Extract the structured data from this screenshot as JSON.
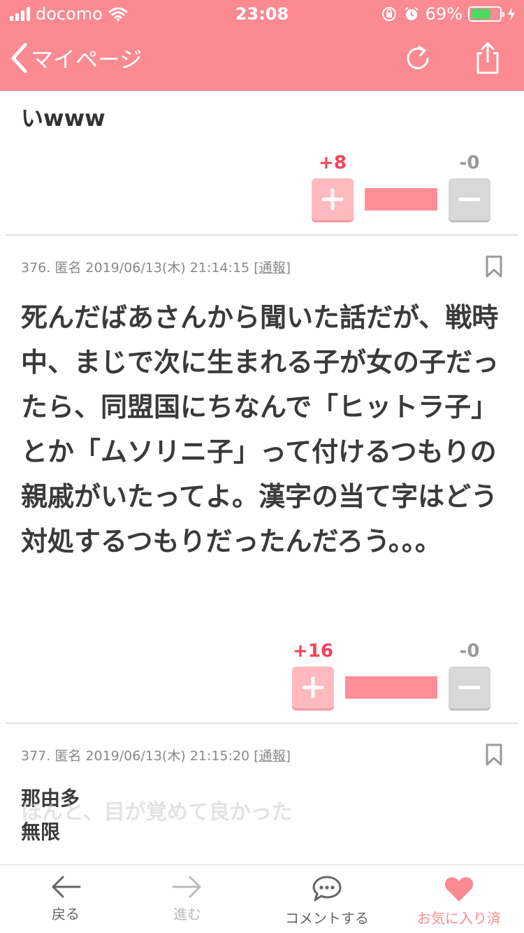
{
  "status_bar": {
    "carrier": "docomo",
    "time": "23:08",
    "battery_percent": "69%",
    "battery_level": 0.69,
    "icons": [
      "signal-icon",
      "wifi-icon",
      "orientation-lock-icon",
      "alarm-icon",
      "battery-icon",
      "charging-icon"
    ]
  },
  "nav": {
    "back_label": "マイページ",
    "icons": [
      "chevron-left-icon",
      "refresh-icon",
      "share-icon"
    ]
  },
  "comments": [
    {
      "id": "prev",
      "body": "いwww",
      "plus": "+8",
      "minus": "-0",
      "ratio": 1.0
    },
    {
      "id": "376",
      "number": "376.",
      "author": "匿名",
      "datetime": "2019/06/13(木) 21:14:15",
      "report": "通報",
      "body": "死んだばあさんから聞いた話だが、戦時中、まじで次に生まれる子が女の子だったら、同盟国にちなんで「ヒットラ子」とか「ムソリニ子」って付けるつもりの親戚がいたってよ。漢字の当て字はどう対処するつもりだったんだろう。。。",
      "plus": "+16",
      "minus": "-0",
      "ratio": 1.0
    },
    {
      "id": "377",
      "number": "377.",
      "author": "匿名",
      "datetime": "2019/06/13(木) 21:15:20",
      "report": "通報",
      "lines": [
        "那由多",
        "無限"
      ]
    }
  ],
  "ghost_text": "ほんと、目が覚めて良かった",
  "tabbar": {
    "back": "戻る",
    "forward": "進む",
    "comment": "コメントする",
    "favorite": "お気に入り済"
  },
  "colors": {
    "brand": "#fb8a92",
    "plus": "#f5425a",
    "bar_fill": "#ff8e98",
    "charging": "#4cd964"
  }
}
